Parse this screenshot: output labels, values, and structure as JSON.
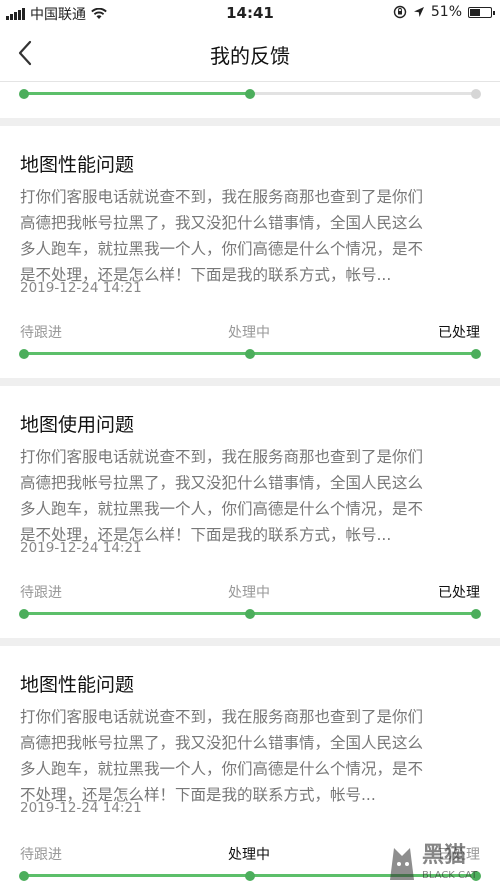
{
  "status_bar": {
    "carrier": "中国联通",
    "time": "14:41",
    "battery": "51%",
    "battery_level": 0.51
  },
  "nav": {
    "title": "我的反馈"
  },
  "progress_labels": {
    "pending": "待跟进",
    "processing": "处理中",
    "done": "已处理"
  },
  "top_progress": {
    "progress": 0.5,
    "steps_reached": 2
  },
  "feedback": [
    {
      "title": "地图性能问题",
      "lines": [
        "打你们客服电话就说查不到，我在服务商那也查到了是你们",
        "高德把我帐号拉黑了，我又没犯什么错事情，全国人民这么",
        "多人跑车，就拉黑我一个人，你们高德是什么个情况，是不",
        "是不处理，还是怎么样！下面是我的联系方式，帐号..."
      ],
      "time": "2019-12-24 14:21",
      "progress": 1.0,
      "steps_reached": 3,
      "current_step": "done"
    },
    {
      "title": "地图使用问题",
      "lines": [
        "打你们客服电话就说查不到，我在服务商那也查到了是你们",
        "高德把我帐号拉黑了，我又没犯什么错事情，全国人民这么",
        "多人跑车，就拉黑我一个人，你们高德是什么个情况，是不",
        "是不处理，还是怎么样！下面是我的联系方式，帐号..."
      ],
      "time": "2019-12-24 14:21",
      "progress": 1.0,
      "steps_reached": 3,
      "current_step": "done"
    },
    {
      "title": "地图性能问题",
      "lines": [
        "打你们客服电话就说查不到，我在服务商那也查到了是你们",
        "高德把我帐号拉黑了，我又没犯什么错事情，全国人民这么",
        "多人跑车，就拉黑我一个人，你们高德是什么个情况，是不",
        "不处理，还是怎么样！下面是我的联系方式，帐号..."
      ],
      "time": "2019-12-24 14:21",
      "progress": 1.0,
      "steps_reached": 3,
      "current_step": "processing"
    }
  ],
  "watermark": {
    "text": "黑猫",
    "subtext": "BLACK CAT"
  },
  "colors": {
    "accent_green": "#4cae5c",
    "track_grey": "#e2e2e2"
  },
  "icons": {
    "back": "chevron-left-icon",
    "wifi": "wifi-icon",
    "signal": "signal-icon",
    "location": "location-arrow-icon",
    "lock": "orientation-lock-icon",
    "battery": "battery-icon"
  }
}
